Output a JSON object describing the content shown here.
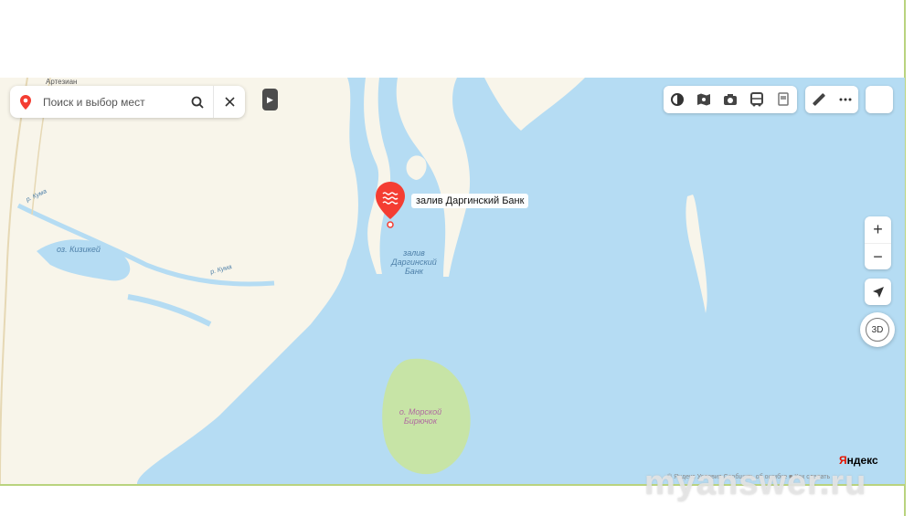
{
  "search": {
    "placeholder": "Поиск и выбор мест"
  },
  "sidebar_toggle": {
    "icon": "triangle-right-icon"
  },
  "toolbar": {
    "buttons": [
      {
        "name": "layers-icon"
      },
      {
        "name": "map-traffic-icon"
      },
      {
        "name": "camera-icon"
      },
      {
        "name": "bus-icon"
      },
      {
        "name": "panorama-icon"
      }
    ],
    "ruler_icon": "ruler-icon",
    "more_icon": "more-icon"
  },
  "controls": {
    "zoom_in": "+",
    "zoom_out": "−",
    "three_d": "3D"
  },
  "map": {
    "selected_place": "залив Даргинский Банк",
    "bay_label": "залив Даргинский Банк",
    "lake_label": "оз. Кизикей",
    "river_label_1": "р. Кума",
    "river_label_2": "р. Кума",
    "island_label": "о. Морской Бирючок",
    "town_label": "Артезиан"
  },
  "colors": {
    "water": "#b5dcf3",
    "land": "#f8f5ea",
    "island_green": "#c7e4a6",
    "pin": "#f43d32"
  },
  "brand": {
    "logo_first": "Я",
    "logo_rest": "ндекс",
    "copyright": "© Яндекс  Условия  Сообщить об ошибке  ■ Как сделать"
  },
  "watermark": "myanswer.ru"
}
